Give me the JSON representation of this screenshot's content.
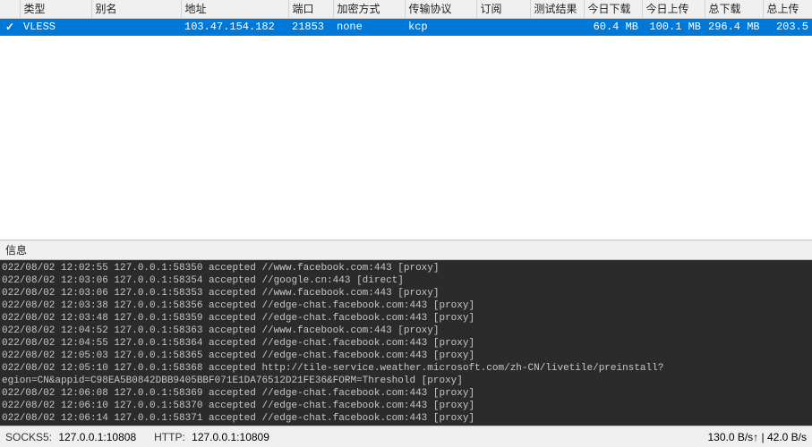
{
  "table": {
    "headers": {
      "type": "类型",
      "alias": "别名",
      "address": "地址",
      "port": "端口",
      "encryption": "加密方式",
      "transport": "传输协议",
      "subscription": "订阅",
      "test_result": "测试结果",
      "today_down": "今日下载",
      "today_up": "今日上传",
      "total_down": "总下载",
      "total_up": "总上传"
    },
    "rows": [
      {
        "active": true,
        "type": "VLESS",
        "alias": "",
        "address": "103.47.154.182",
        "port": "21853",
        "encryption": "none",
        "transport": "kcp",
        "subscription": "",
        "test_result": "",
        "today_down": "60.4 MB",
        "today_up": "100.1 MB",
        "total_down": "296.4 MB",
        "total_up": "203.5"
      }
    ]
  },
  "info_label": "信息",
  "log_lines": [
    "022/08/02 12:02:55 127.0.0.1:58350 accepted //www.facebook.com:443 [proxy]",
    "022/08/02 12:03:06 127.0.0.1:58354 accepted //google.cn:443 [direct]",
    "022/08/02 12:03:06 127.0.0.1:58353 accepted //www.facebook.com:443 [proxy]",
    "022/08/02 12:03:38 127.0.0.1:58356 accepted //edge-chat.facebook.com:443 [proxy]",
    "022/08/02 12:03:48 127.0.0.1:58359 accepted //edge-chat.facebook.com:443 [proxy]",
    "022/08/02 12:04:52 127.0.0.1:58363 accepted //www.facebook.com:443 [proxy]",
    "022/08/02 12:04:55 127.0.0.1:58364 accepted //edge-chat.facebook.com:443 [proxy]",
    "022/08/02 12:05:03 127.0.0.1:58365 accepted //edge-chat.facebook.com:443 [proxy]",
    "022/08/02 12:05:10 127.0.0.1:58368 accepted http://tile-service.weather.microsoft.com/zh-CN/livetile/preinstall?",
    "egion=CN&appid=C98EA5B0842DBB9405BBF071E1DA76512D21FE36&FORM=Threshold [proxy]",
    "022/08/02 12:06:08 127.0.0.1:58369 accepted //edge-chat.facebook.com:443 [proxy]",
    "022/08/02 12:06:10 127.0.0.1:58370 accepted //edge-chat.facebook.com:443 [proxy]",
    "022/08/02 12:06:14 127.0.0.1:58371 accepted //edge-chat.facebook.com:443 [proxy]"
  ],
  "status": {
    "socks_label": "SOCKS5:",
    "socks_value": "127.0.0.1:10808",
    "http_label": "HTTP:",
    "http_value": "127.0.0.1:10809",
    "speed": "130.0 B/s↑ | 42.0 B/s"
  }
}
